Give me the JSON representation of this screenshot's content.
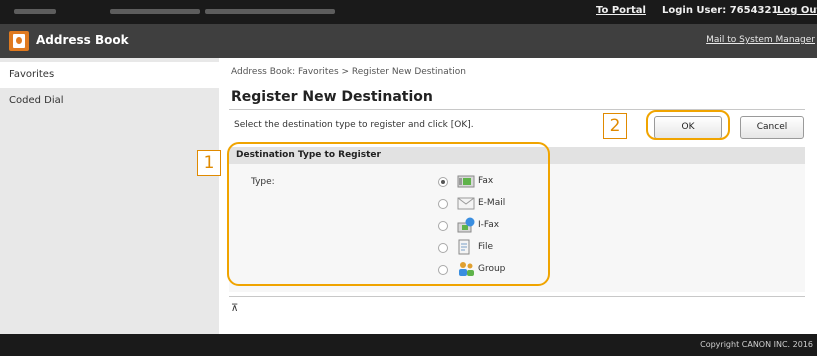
{
  "topbar": {
    "portal_link": "To Portal",
    "login_user": "Login User:  7654321",
    "logout": "Log Out"
  },
  "app": {
    "title": "Address Book",
    "mail_link": "Mail to System Manager"
  },
  "sidebar": {
    "items": [
      {
        "label": "Favorites"
      },
      {
        "label": "Coded Dial"
      }
    ]
  },
  "main": {
    "breadcrumb": "Address Book: Favorites > Register New Destination",
    "title": "Register New Destination",
    "instruction": "Select the destination type to register and click [OK].",
    "ok_label": "OK",
    "cancel_label": "Cancel",
    "section_title": "Destination Type to Register",
    "type_label": "Type:",
    "options": [
      {
        "label": "Fax",
        "icon": "fax-icon",
        "checked": true
      },
      {
        "label": "E-Mail",
        "icon": "email-icon",
        "checked": false
      },
      {
        "label": "I-Fax",
        "icon": "ifax-icon",
        "checked": false
      },
      {
        "label": "File",
        "icon": "file-icon",
        "checked": false
      },
      {
        "label": "Group",
        "icon": "group-icon",
        "checked": false
      }
    ],
    "back_to_top": "⊼"
  },
  "callouts": {
    "one": "1",
    "two": "2"
  },
  "footer": {
    "copyright": "Copyright CANON INC. 2016"
  },
  "colors": {
    "accent": "#f0a400",
    "topbar": "#1a1a1a",
    "titlebar": "#3f3f3f"
  }
}
